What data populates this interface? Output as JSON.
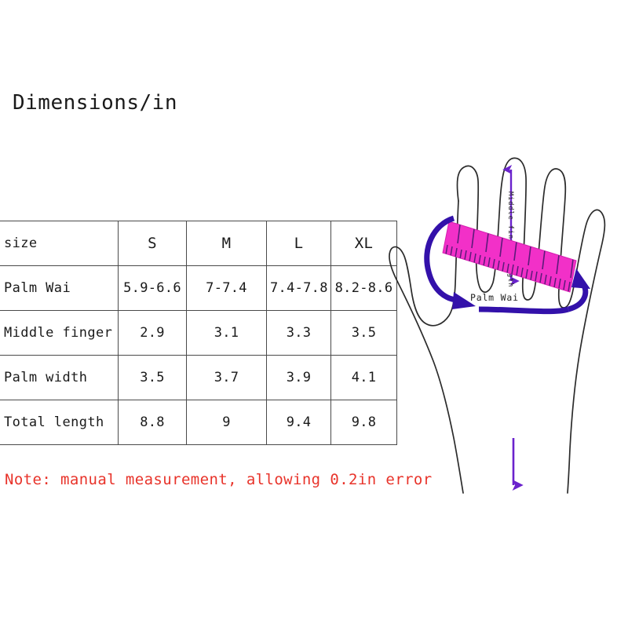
{
  "title": "Dimensions/in",
  "table": {
    "columns": [
      "size",
      "S",
      "M",
      "L",
      "XL"
    ],
    "rows": [
      {
        "label": "Palm Wai",
        "values": [
          "5.9-6.6",
          "7-7.4",
          "7.4-7.8",
          "8.2-8.6"
        ]
      },
      {
        "label": "Middle finger",
        "values": [
          "2.9",
          "3.1",
          "3.3",
          "3.5"
        ]
      },
      {
        "label": "Palm width",
        "values": [
          "3.5",
          "3.7",
          "3.9",
          "4.1"
        ]
      },
      {
        "label": "Total length",
        "values": [
          "8.8",
          "9",
          "9.4",
          "9.8"
        ]
      }
    ]
  },
  "note": "Note: manual measurement, allowing 0.2in error",
  "diagram": {
    "middle_finger_label": "Middle finger length",
    "palm_wai_label": "Palm Wai",
    "colors": {
      "hand_outline": "#2b2b2b",
      "ruler_fill": "#f230c8",
      "ruler_tick": "#5d1a7a",
      "arrow_purple": "#6a22cc",
      "arrow_blue": "#3311aa",
      "note_red": "#e8332a"
    }
  }
}
